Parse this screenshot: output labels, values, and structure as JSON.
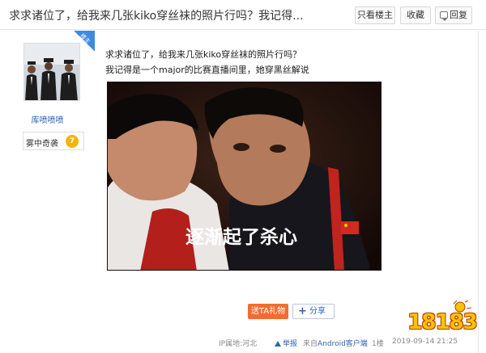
{
  "header": {
    "title": "求求诸位了，给我来几张kiko穿丝袜的照片行吗？我记得...",
    "only_op_label": "只看楼主",
    "favorite_label": "收藏",
    "reply_label": "回复"
  },
  "author": {
    "username": "库喷喷喷",
    "level_name": "雾中奇袭",
    "level_number": "7",
    "badge": "楼主"
  },
  "post": {
    "line1": "求求诸位了，给我来几张kiko穿丝袜的照片行吗？",
    "line2": "我记得是一个major的比赛直播间里，她穿黑丝解说",
    "image_caption": "逐渐起了杀心"
  },
  "actions": {
    "gift_label": "送TA礼物",
    "share_label": "分享"
  },
  "meta": {
    "ip_location": "IP属地:河北",
    "report_label": "举报",
    "client_prefix": "来自",
    "client_name": "Android客户端",
    "floor": "1楼",
    "timestamp": "2019-09-14 21:25"
  },
  "watermark": {
    "text": "18183"
  },
  "icons": {
    "reply": "reply-icon",
    "share": "plus-icon",
    "report": "warning-icon"
  },
  "colors": {
    "link": "#2d64b3",
    "gift_button": "#f26c2f",
    "op_badge": "#3d8ae0",
    "level_badge": "#f5b400"
  }
}
